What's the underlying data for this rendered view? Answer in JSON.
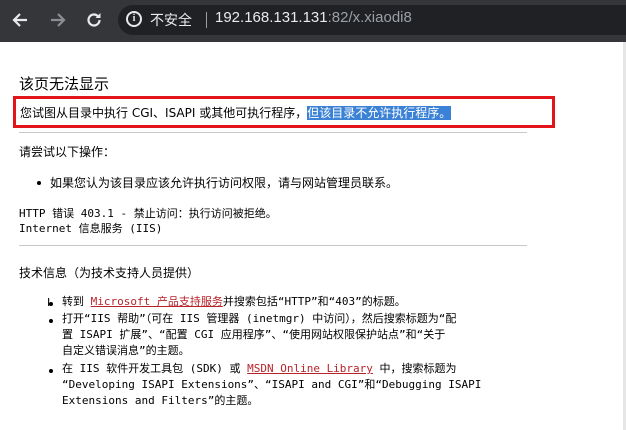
{
  "browser": {
    "security_label": "不安全",
    "url_host": "192.168.131.131",
    "url_rest": ":82/x.xiaodi8"
  },
  "page": {
    "title": "该页无法显示",
    "message_plain": "您试图从目录中执行 CGI、ISAPI 或其他可执行程序，",
    "message_highlight": "但该目录不允许执行程序。",
    "try_heading": "请尝试以下操作：",
    "try_item": "如果您认为该目录应该允许执行访问权限，请与网站管理员联系。",
    "error_line": "HTTP 错误 403.1 - 禁止访问：执行访问被拒绝。",
    "service_line": "Internet 信息服务 (IIS)",
    "tech_heading": "技术信息（为技术支持人员提供）",
    "tech_items": [
      {
        "prefix": "转到 ",
        "link": "Microsoft 产品支持服务",
        "suffix": "并搜索包括“HTTP”和“403”的标题。"
      },
      {
        "lines": [
          "打开“IIS 帮助”（可在 IIS 管理器 (inetmgr) 中访问），然后搜索标题为“配",
          "置 ISAPI 扩展”、“配置 CGI 应用程序”、“使用网站权限保护站点”和“关于",
          "自定义错误消息”的主题。"
        ]
      },
      {
        "prefix": "在 IIS 软件开发工具包 (SDK) 或 ",
        "link": "MSDN Online Library",
        "suffix": " 中，搜索标题为",
        "lines": [
          "“Developing ISAPI Extensions”、“ISAPI and CGI”和“Debugging ISAPI",
          "Extensions and Filters”的主题。"
        ]
      }
    ]
  },
  "colors": {
    "highlight_box": "#e4141b",
    "selection": "#3b82d6",
    "link": "#b8232a",
    "chrome_bg": "#35363a"
  },
  "icons": [
    "back-arrow-icon",
    "forward-arrow-icon",
    "reload-icon",
    "info-icon"
  ]
}
